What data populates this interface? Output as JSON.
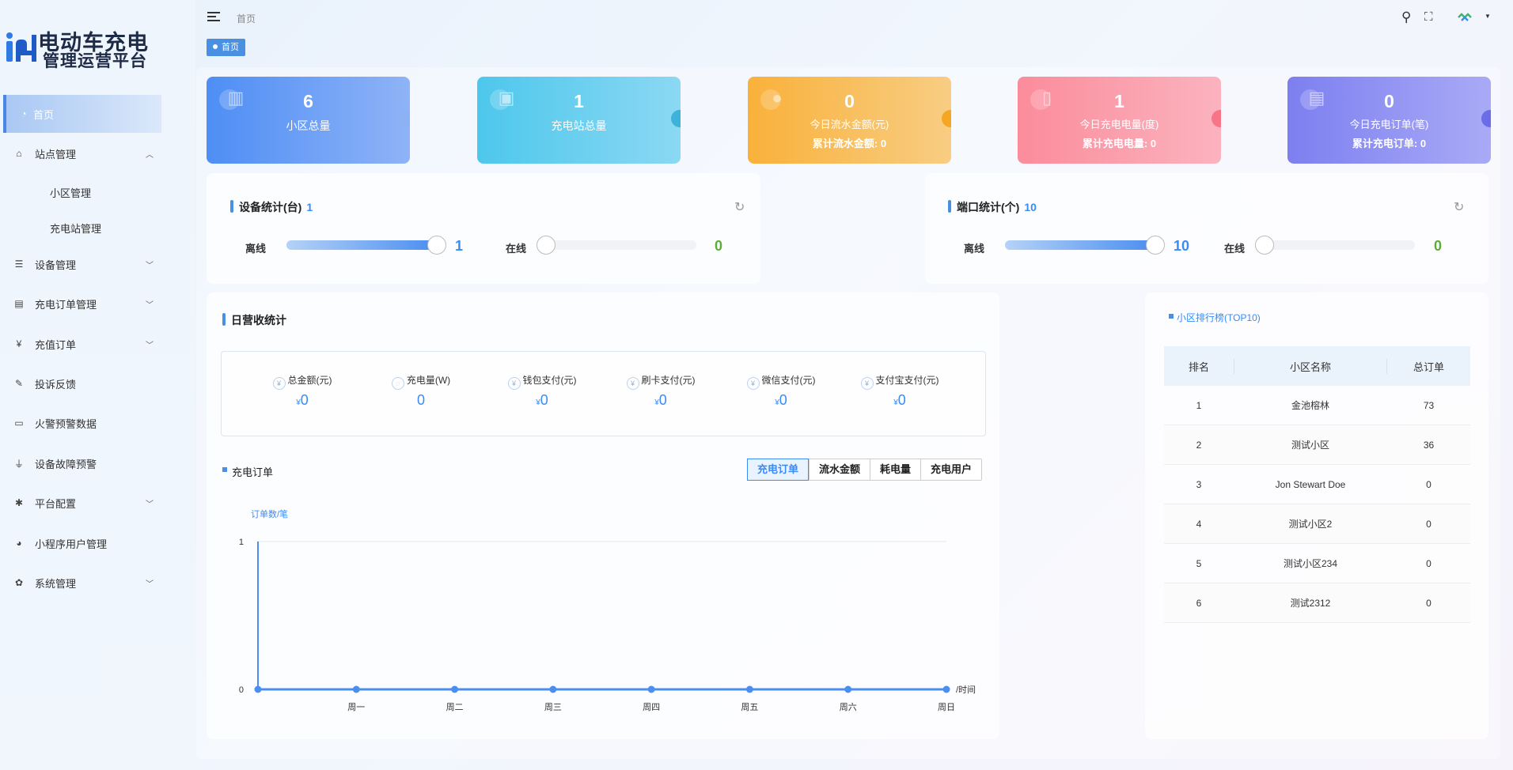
{
  "app": {
    "title_line1": "电动车充电",
    "title_line2": "管理运营平台"
  },
  "sidebar": {
    "items": [
      {
        "label": "首页",
        "icon": "dashboard-icon"
      },
      {
        "label": "站点管理",
        "icon": "building-icon",
        "expanded": true
      },
      {
        "label": "小区管理"
      },
      {
        "label": "充电站管理"
      },
      {
        "label": "设备管理",
        "icon": "sliders-icon"
      },
      {
        "label": "充电订单管理",
        "icon": "receipt-icon"
      },
      {
        "label": "充值订单",
        "icon": "yen-icon"
      },
      {
        "label": "投诉反馈",
        "icon": "edit-icon"
      },
      {
        "label": "火警预警数据",
        "icon": "monitor-icon"
      },
      {
        "label": "设备故障预警",
        "icon": "plug-icon"
      },
      {
        "label": "平台配置",
        "icon": "bug-icon"
      },
      {
        "label": "小程序用户管理",
        "icon": "wechat-icon"
      },
      {
        "label": "系统管理",
        "icon": "gear-icon"
      }
    ]
  },
  "header": {
    "breadcrumb": "首页",
    "active_tag": "首页"
  },
  "cards": [
    {
      "value": "6",
      "label": "小区总量",
      "sub": ""
    },
    {
      "value": "1",
      "label": "充电站总量",
      "sub": ""
    },
    {
      "value": "0",
      "label": "今日流水金额(元)",
      "sub": "累计流水金额: 0"
    },
    {
      "value": "1",
      "label": "今日充电电量(度)",
      "sub": "累计充电电量: 0"
    },
    {
      "value": "0",
      "label": "今日充电订单(笔)",
      "sub": "累计充电订单: 0"
    }
  ],
  "device_stats": {
    "title": "设备统计(台)",
    "total": "1",
    "offline_label": "离线",
    "offline_value": "1",
    "offline_fraction": 1.0,
    "online_label": "在线",
    "online_value": "0",
    "online_fraction": 0.0
  },
  "port_stats": {
    "title": "端口统计(个)",
    "total": "10",
    "offline_label": "离线",
    "offline_value": "10",
    "offline_fraction": 1.0,
    "online_label": "在线",
    "online_value": "0",
    "online_fraction": 0.0
  },
  "revenue": {
    "title": "日营收统计",
    "currency": "¥",
    "items": [
      {
        "label": "总金额(元)",
        "value": "0",
        "currency": true
      },
      {
        "label": "充电量(W)",
        "value": "0",
        "currency": false
      },
      {
        "label": "钱包支付(元)",
        "value": "0",
        "currency": true
      },
      {
        "label": "刷卡支付(元)",
        "value": "0",
        "currency": true
      },
      {
        "label": "微信支付(元)",
        "value": "0",
        "currency": true
      },
      {
        "label": "支付宝支付(元)",
        "value": "0",
        "currency": true
      }
    ]
  },
  "order_chart": {
    "title": "充电订单",
    "tabs": [
      "充电订单",
      "流水金额",
      "耗电量",
      "充电用户"
    ],
    "active_tab": 0
  },
  "chart_data": {
    "type": "line",
    "ylabel": "订单数/笔",
    "xlabel": "/时间",
    "categories": [
      "",
      "周一",
      "周二",
      "周三",
      "周四",
      "周五",
      "周六",
      "周日"
    ],
    "series": [
      {
        "values": [
          0,
          0,
          0,
          0,
          0,
          0,
          0,
          0
        ]
      }
    ],
    "ylim": [
      0,
      1
    ],
    "yticks": [
      "0",
      "1"
    ],
    "color": "#4a8ef0"
  },
  "ranking": {
    "title": "小区排行榜(TOP10)",
    "headers": [
      "排名",
      "小区名称",
      "总订单"
    ],
    "rows": [
      [
        "1",
        "金池榕林",
        "73"
      ],
      [
        "2",
        "测试小区",
        "36"
      ],
      [
        "3",
        "Jon Stewart Doe",
        "0"
      ],
      [
        "4",
        "测试小区2",
        "0"
      ],
      [
        "5",
        "测试小区234",
        "0"
      ],
      [
        "6",
        "测试2312",
        "0"
      ]
    ]
  }
}
